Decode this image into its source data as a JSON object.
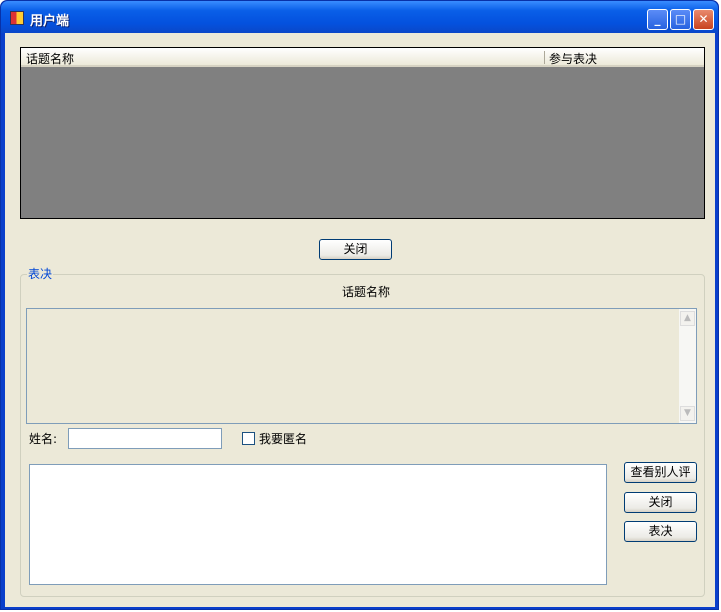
{
  "window": {
    "title": "用户端"
  },
  "grid": {
    "columns": [
      "话题名称",
      "参与表决"
    ]
  },
  "top_close_button": "关闭",
  "vote_group": {
    "legend": "表决",
    "topic_label": "话题名称",
    "name_label": "姓名:",
    "name_value": "",
    "anonymous_label": "我要匿名",
    "anonymous_checked": false,
    "comment_value": "",
    "buttons": {
      "view_others": "查看别人评",
      "close": "关闭",
      "vote": "表决"
    }
  }
}
